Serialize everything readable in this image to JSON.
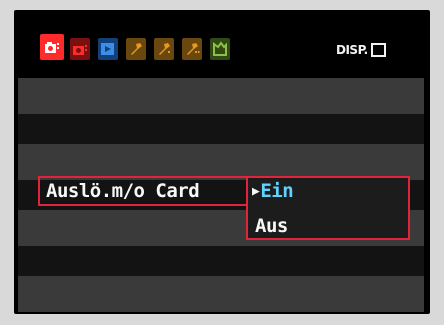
{
  "colors": {
    "accent_red": "#e3223b",
    "selected_blue": "#5fd2ff",
    "tab_shooting": "#ff2a2a",
    "tab_playback": "#3b8de6",
    "tab_setup": "#e39a22",
    "tab_custom": "#8fbf4a"
  },
  "menu": {
    "tabs": [
      {
        "icon": "camera-shooting-1-icon",
        "active": true
      },
      {
        "icon": "camera-shooting-2-icon",
        "active": false
      },
      {
        "icon": "playback-icon",
        "active": false
      },
      {
        "icon": "setup-1-icon",
        "active": false
      },
      {
        "icon": "setup-2-icon",
        "active": false
      },
      {
        "icon": "setup-3-icon",
        "active": false
      },
      {
        "icon": "custom-function-icon",
        "active": false
      }
    ],
    "disp_label": "DISP.",
    "setting": {
      "label": "Auslö.m/o Card",
      "options": [
        "Ein",
        "Aus"
      ],
      "selected": "Ein",
      "cursor": "▶"
    }
  }
}
